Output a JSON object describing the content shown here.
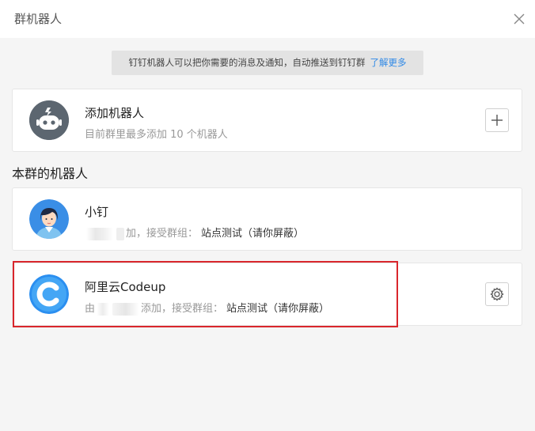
{
  "header": {
    "title": "群机器人"
  },
  "notice": {
    "text": "钉钉机器人可以把你需要的消息及通知，自动推送到钉钉群",
    "link": "了解更多"
  },
  "add_robot": {
    "title": "添加机器人",
    "subtitle": "目前群里最多添加 10 个机器人"
  },
  "section": {
    "title": "本群的机器人"
  },
  "robots": [
    {
      "name": "小钉",
      "added_suffix": "加，接受群组：",
      "group": "站点测试（请你屏蔽）"
    },
    {
      "name": "阿里云Codeup",
      "added_prefix": "由",
      "added_suffix": "添加，接受群组：",
      "group": "站点测试（请你屏蔽）"
    }
  ],
  "colors": {
    "link": "#2e88e6",
    "highlight": "#d9262c",
    "robot_avatar_bg": "#5c6670",
    "xiaoding_avatar_bg": "#3a8ee6",
    "codeup_avatar_bg": "#2b8ff0"
  }
}
